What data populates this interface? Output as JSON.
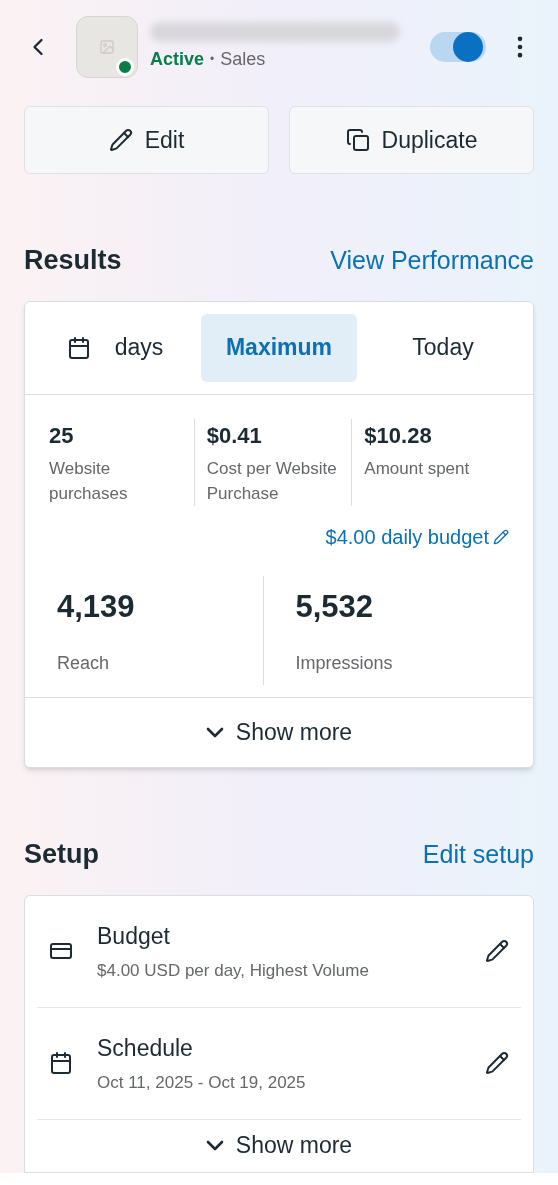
{
  "header": {
    "status": "Active",
    "separator": "•",
    "objective": "Sales",
    "toggle_on": true
  },
  "actions": [
    {
      "kind": "edit",
      "label": "Edit"
    },
    {
      "kind": "duplicate",
      "label": "Duplicate"
    }
  ],
  "results": {
    "title": "Results",
    "link": "View Performance",
    "tabs": [
      {
        "label": "days",
        "kind": "calendar",
        "selected": false
      },
      {
        "label": "Maximum",
        "selected": true
      },
      {
        "label": "Today",
        "selected": false
      }
    ],
    "metrics": [
      {
        "value": "25",
        "label": "Website purchases"
      },
      {
        "value": "$0.41",
        "label": "Cost per Website Purchase"
      },
      {
        "value": "$10.28",
        "label": "Amount spent"
      }
    ],
    "budget_link": "$4.00 daily budget",
    "totals": [
      {
        "value": "4,139",
        "label": "Reach"
      },
      {
        "value": "5,532",
        "label": "Impressions"
      }
    ],
    "show_more": "Show more"
  },
  "setup": {
    "title": "Setup",
    "link": "Edit setup",
    "rows": [
      {
        "kind": "budget",
        "title": "Budget",
        "detail": "$4.00 USD per day, Highest Volume"
      },
      {
        "kind": "schedule",
        "title": "Schedule",
        "detail": "Oct 11, 2025 - Oct 19, 2025"
      }
    ],
    "show_more": "Show more"
  }
}
